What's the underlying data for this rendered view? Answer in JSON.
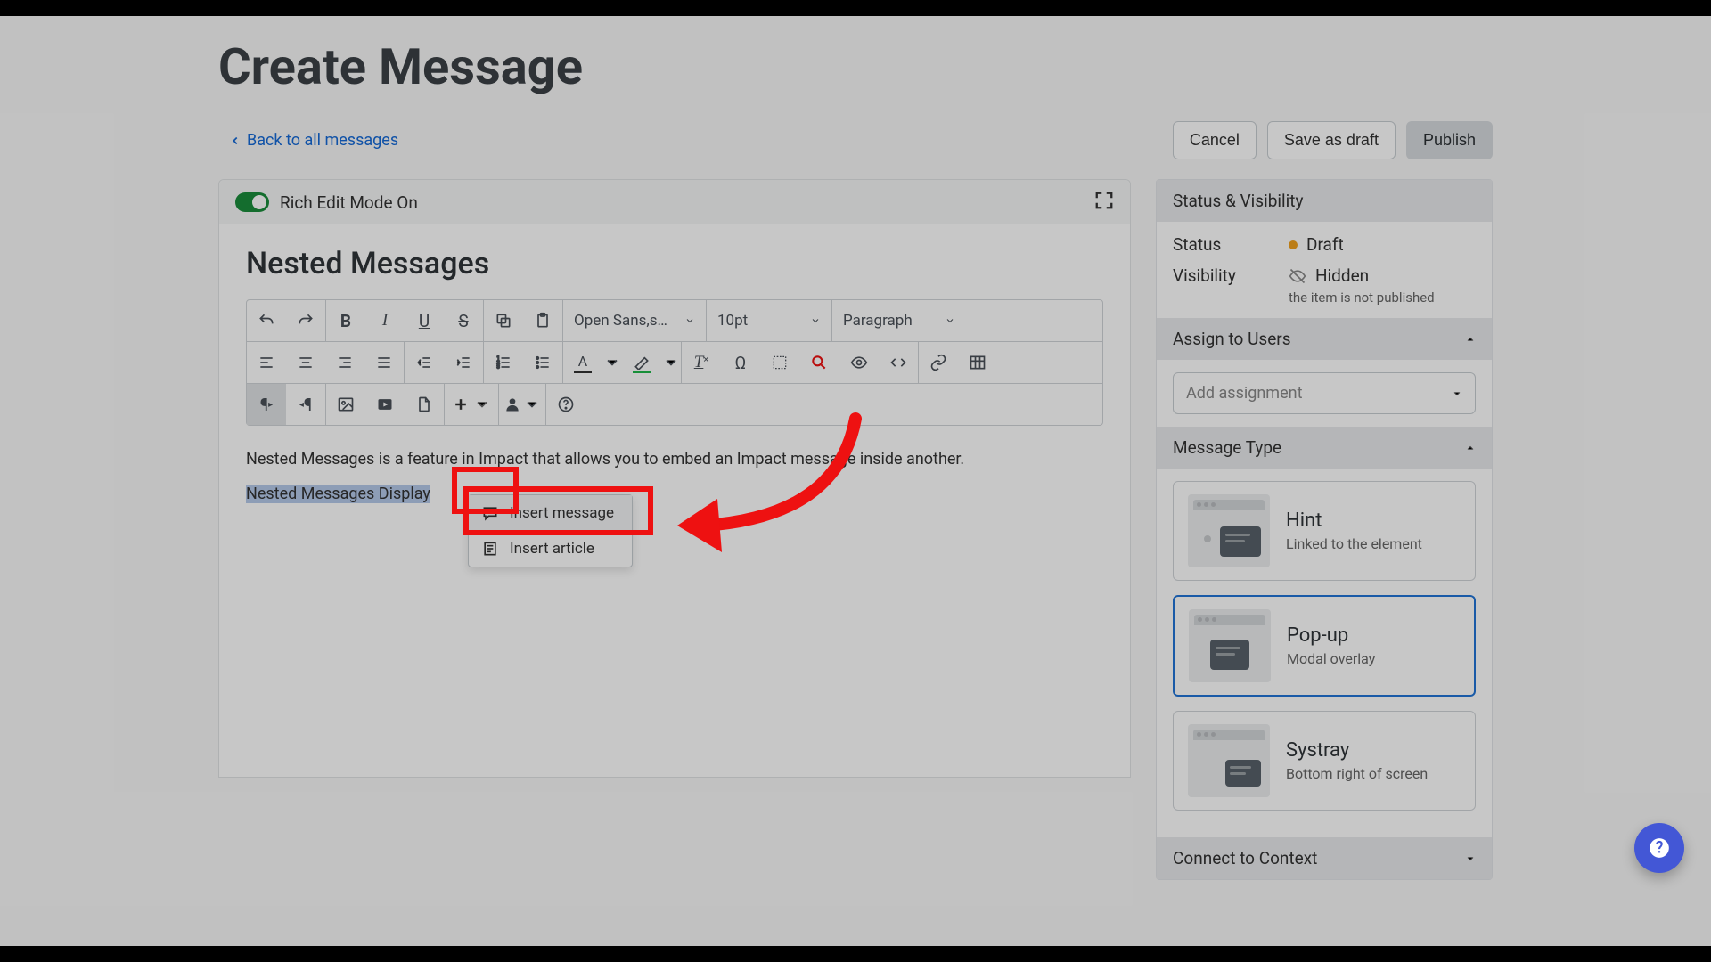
{
  "page": {
    "title": "Create Message"
  },
  "nav": {
    "back": "Back to all messages"
  },
  "actions": {
    "cancel": "Cancel",
    "save_draft": "Save as draft",
    "publish": "Publish"
  },
  "editor": {
    "mode_label": "Rich Edit Mode On",
    "doc_title": "Nested Messages",
    "font_family": "Open Sans,s…",
    "font_size": "10pt",
    "block_format": "Paragraph",
    "body_text": "Nested Messages is a feature in Impact that allows you to embed an Impact message inside another.",
    "highlight_text": "Nested Messages Display"
  },
  "insert_menu": {
    "item1": "Insert message",
    "item2": "Insert article"
  },
  "sidebar": {
    "status_section": "Status & Visibility",
    "status_label": "Status",
    "status_value": "Draft",
    "visibility_label": "Visibility",
    "visibility_value": "Hidden",
    "visibility_note": "the item is not published",
    "assign_section": "Assign to Users",
    "assign_placeholder": "Add assignment",
    "msgtype_section": "Message Type",
    "types": {
      "hint": {
        "title": "Hint",
        "sub": "Linked to the element"
      },
      "popup": {
        "title": "Pop-up",
        "sub": "Modal overlay"
      },
      "systray": {
        "title": "Systray",
        "sub": "Bottom right of screen"
      }
    },
    "connect_section": "Connect to Context"
  }
}
